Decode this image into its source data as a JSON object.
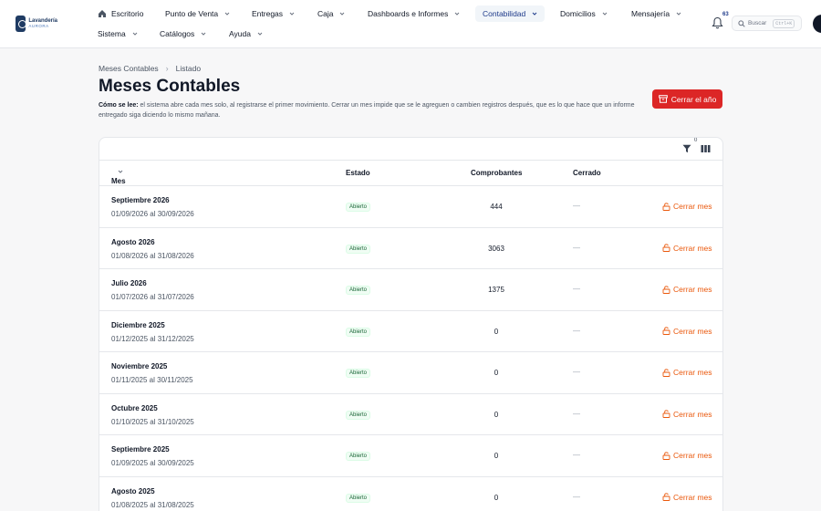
{
  "brand": {
    "name": "Lavandería",
    "tagline": "AURORA"
  },
  "nav": {
    "row1": [
      {
        "label": "Escritorio",
        "chevron": false,
        "icon": "home-icon"
      },
      {
        "label": "Punto de Venta",
        "chevron": true
      },
      {
        "label": "Entregas",
        "chevron": true
      },
      {
        "label": "Caja",
        "chevron": true
      },
      {
        "label": "Dashboards e Informes",
        "chevron": true
      },
      {
        "label": "Contabilidad",
        "chevron": true,
        "active": true
      },
      {
        "label": "Domicilios",
        "chevron": true
      },
      {
        "label": "Mensajería",
        "chevron": true
      }
    ],
    "row2": [
      {
        "label": "Sistema",
        "chevron": true
      },
      {
        "label": "Catálogos",
        "chevron": true
      },
      {
        "label": "Ayuda",
        "chevron": true
      }
    ]
  },
  "notifications": {
    "count": "63"
  },
  "search": {
    "label": "Buscar",
    "shortcut": "Ctrl+K"
  },
  "breadcrumb": {
    "items": [
      "Meses Contables",
      "Listado"
    ]
  },
  "page": {
    "title": "Meses Contables",
    "desc_lead": "Cómo se lee:",
    "desc_text": "el sistema abre cada mes solo, al registrarse el primer movimiento. Cerrar un mes impide que se le agreguen o cambien registros después, que es lo que hace que un informe entregado siga diciendo lo mismo mañana.",
    "close_year_label": "Cerrar el año"
  },
  "table": {
    "filter_count": "0",
    "headers": {
      "mes": "Mes",
      "estado": "Estado",
      "comprobantes": "Comprobantes",
      "cerrado": "Cerrado"
    },
    "action_label": "Cerrar mes",
    "rows": [
      {
        "name": "Septiembre 2026",
        "range": "01/09/2026 al 30/09/2026",
        "status": "Abierto",
        "comprobantes": "444",
        "cerrado": "—"
      },
      {
        "name": "Agosto 2026",
        "range": "01/08/2026 al 31/08/2026",
        "status": "Abierto",
        "comprobantes": "3063",
        "cerrado": "—"
      },
      {
        "name": "Julio 2026",
        "range": "01/07/2026 al 31/07/2026",
        "status": "Abierto",
        "comprobantes": "1375",
        "cerrado": "—"
      },
      {
        "name": "Diciembre 2025",
        "range": "01/12/2025 al 31/12/2025",
        "status": "Abierto",
        "comprobantes": "0",
        "cerrado": "—"
      },
      {
        "name": "Noviembre 2025",
        "range": "01/11/2025 al 30/11/2025",
        "status": "Abierto",
        "comprobantes": "0",
        "cerrado": "—"
      },
      {
        "name": "Octubre 2025",
        "range": "01/10/2025 al 31/10/2025",
        "status": "Abierto",
        "comprobantes": "0",
        "cerrado": "—"
      },
      {
        "name": "Septiembre 2025",
        "range": "01/09/2025 al 30/09/2025",
        "status": "Abierto",
        "comprobantes": "0",
        "cerrado": "—"
      },
      {
        "name": "Agosto 2025",
        "range": "01/08/2025 al 31/08/2025",
        "status": "Abierto",
        "comprobantes": "0",
        "cerrado": "—"
      }
    ]
  },
  "colors": {
    "primary": "#1e3a8a",
    "danger": "#dc2626",
    "action": "#ea580c"
  }
}
